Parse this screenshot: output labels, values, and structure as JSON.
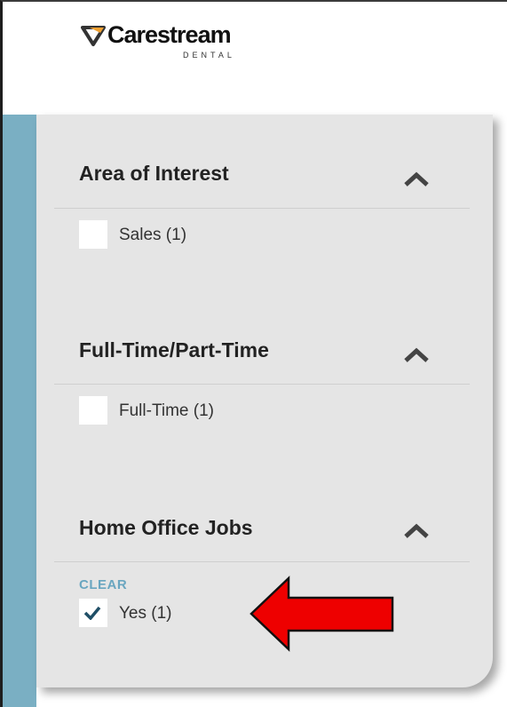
{
  "brand": {
    "name": "Carestream",
    "subtitle": "DENTAL",
    "logo_icon": "carestream-tooth-icon"
  },
  "filters": [
    {
      "title": "Area of Interest",
      "toggle_icon": "chevron-up-icon",
      "options": [
        {
          "label": "Sales (1)",
          "checked": false
        }
      ]
    },
    {
      "title": "Full-Time/Part-Time",
      "toggle_icon": "chevron-up-icon",
      "options": [
        {
          "label": "Full-Time (1)",
          "checked": false
        }
      ]
    },
    {
      "title": "Home Office Jobs",
      "toggle_icon": "chevron-up-icon",
      "clear_label": "CLEAR",
      "options": [
        {
          "label": "Yes (1)",
          "checked": true
        }
      ]
    }
  ],
  "annotation": {
    "icon": "red-arrow-left-icon",
    "color": "#ee0000"
  },
  "colors": {
    "accent_strip": "#7aafc3",
    "panel_bg": "#e5e5e5",
    "clear_link": "#6aa6c0",
    "checkmark": "#1f4e66"
  }
}
